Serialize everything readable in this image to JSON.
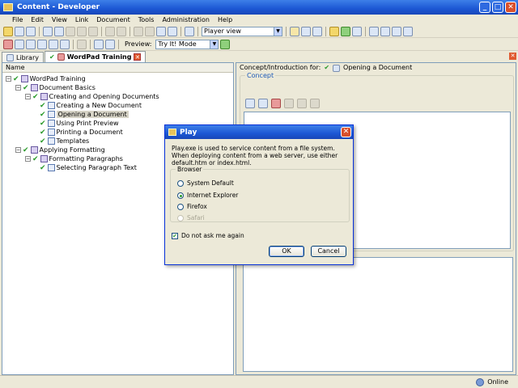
{
  "window": {
    "title": "Content - Developer"
  },
  "menu": [
    "File",
    "Edit",
    "View",
    "Link",
    "Document",
    "Tools",
    "Administration",
    "Help"
  ],
  "toolbar": {
    "view_select": "Player view",
    "preview_label": "Preview:",
    "preview_select": "Try It! Mode"
  },
  "tabs": [
    {
      "label": "Library"
    },
    {
      "label": "WordPad Training"
    }
  ],
  "tree": {
    "header": "Name",
    "items": [
      {
        "label": "WordPad Training"
      },
      {
        "label": "Document Basics"
      },
      {
        "label": "Creating and Opening Documents"
      },
      {
        "label": "Creating a New Document"
      },
      {
        "label": "Opening a Document"
      },
      {
        "label": "Using Print Preview"
      },
      {
        "label": "Printing a Document"
      },
      {
        "label": "Templates"
      },
      {
        "label": "Applying Formatting"
      },
      {
        "label": "Formatting Paragraphs"
      },
      {
        "label": "Selecting Paragraph Text"
      }
    ]
  },
  "right": {
    "header_prefix": "Concept/Introduction for:",
    "header_doc": "Opening a Document",
    "concept_label": "Concept"
  },
  "dialog": {
    "title": "Play",
    "message": "Play.exe is used to service content from a file system. When deploying content from a web server, use either default.htm or index.html.",
    "group_label": "Browser",
    "options": [
      "System Default",
      "Internet Explorer",
      "Firefox",
      "Safari"
    ],
    "checkbox_label": "Do not ask me again",
    "ok_label": "OK",
    "cancel_label": "Cancel"
  },
  "status": {
    "text": "Online"
  }
}
